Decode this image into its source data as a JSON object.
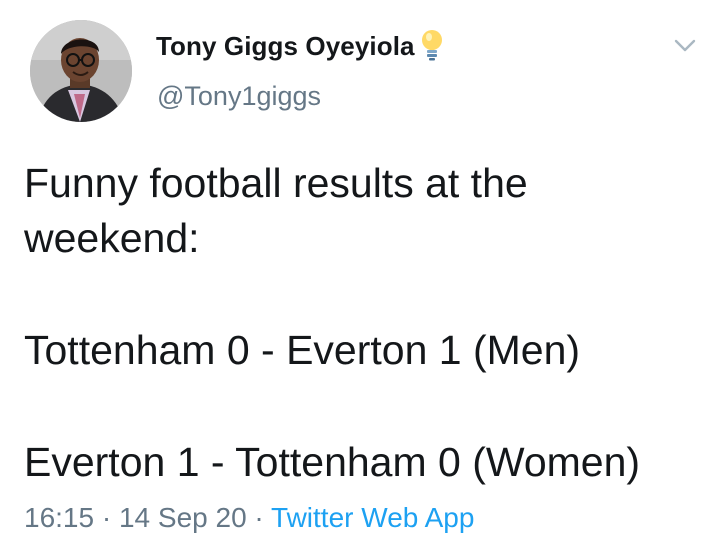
{
  "tweet": {
    "author": {
      "display_name": "Tony Giggs Oyeyiola",
      "handle": "@Tony1giggs",
      "name_emoji_icon": "light-bulb-icon",
      "avatar_icon": "profile-photo"
    },
    "menu_icon": "chevron-down-icon",
    "text_lines": [
      "Funny football results at the weekend:",
      "Tottenham 0 - Everton 1 (Men)",
      "Everton 1 - Tottenham 0 (Women)"
    ],
    "meta": {
      "time": "16:15",
      "separator": "·",
      "date": "14 Sep 20",
      "source": "Twitter Web App"
    }
  },
  "colors": {
    "text": "#14171a",
    "secondary": "#657786",
    "link": "#1da1f2",
    "background": "#ffffff"
  }
}
